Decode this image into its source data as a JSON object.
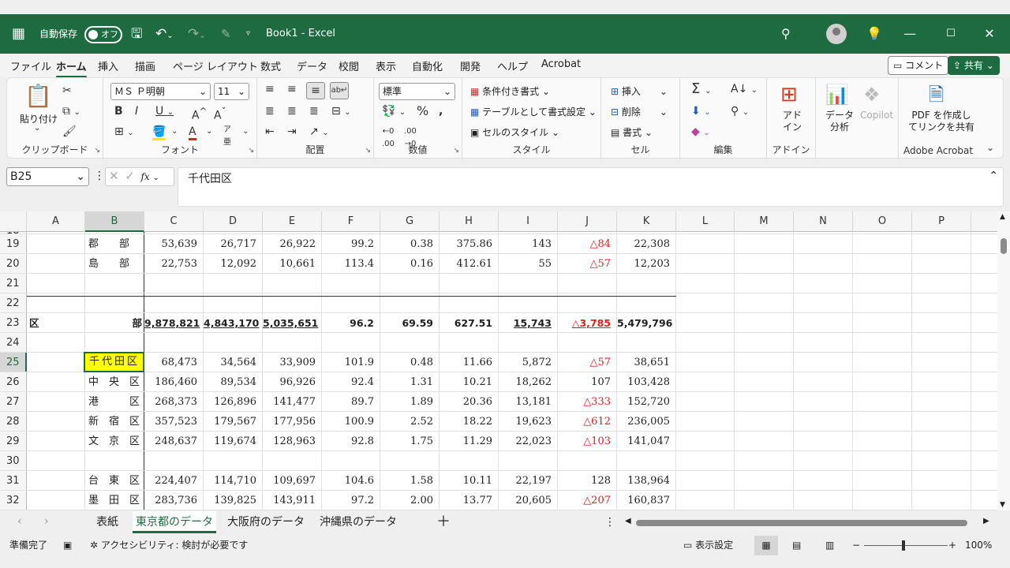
{
  "title": {
    "autosave_label": "自動保存",
    "autosave_state": "オフ",
    "filename": "Book1  -  Excel"
  },
  "menu": {
    "items": [
      "ファイル",
      "ホーム",
      "挿入",
      "描画",
      "ページ レイアウト",
      "数式",
      "データ",
      "校閲",
      "表示",
      "自動化",
      "開発",
      "ヘルプ",
      "Acrobat"
    ],
    "active": "ホーム",
    "comment_button": "コメント",
    "share_button": "共有"
  },
  "ribbon": {
    "clipboard": {
      "label": "クリップボード",
      "paste": "貼り付け"
    },
    "font": {
      "label": "フォント",
      "font_name": "ＭＳ Ｐ明朝",
      "font_size": "11"
    },
    "alignment": {
      "label": "配置"
    },
    "number": {
      "label": "数値",
      "format": "標準"
    },
    "styles": {
      "label": "スタイル",
      "conditional": "条件付き書式",
      "table": "テーブルとして書式設定",
      "cell_styles": "セルのスタイル"
    },
    "cells": {
      "label": "セル",
      "insert": "挿入",
      "delete": "削除",
      "format": "書式"
    },
    "editing": {
      "label": "編集"
    },
    "addins": {
      "label": "アドイン",
      "addin_button": "アド\nイン"
    },
    "analysis": {
      "data_analysis": "データ\n分析",
      "copilot": "Copilot"
    },
    "acrobat": {
      "label": "Adobe Acrobat",
      "pdf_button": "PDF を作成し\nてリンクを共有"
    }
  },
  "formula_bar": {
    "name_box": "B25",
    "fx": "fx",
    "value": "千代田区"
  },
  "grid": {
    "columns": [
      "A",
      "B",
      "C",
      "D",
      "E",
      "F",
      "G",
      "H",
      "I",
      "J",
      "K",
      "L",
      "M",
      "N",
      "O",
      "P"
    ],
    "selected_cell": "B25",
    "partial_top_row": "18",
    "rows": [
      {
        "num": "19",
        "b": "郡　　部",
        "c": "53,639",
        "d": "26,717",
        "e": "26,922",
        "f": "99.2",
        "g": "0.38",
        "h": "375.86",
        "i": "143",
        "j": "△84",
        "k": "22,308"
      },
      {
        "num": "20",
        "b": "島　　部",
        "c": "22,753",
        "d": "12,092",
        "e": "10,661",
        "f": "113.4",
        "g": "0.16",
        "h": "412.61",
        "i": "55",
        "j": "△57",
        "k": "12,203"
      },
      {
        "num": "21"
      },
      {
        "num": "22"
      },
      {
        "num": "23",
        "a": "区",
        "b": "部",
        "c": "9,878,821",
        "d": "4,843,170",
        "e": "5,035,651",
        "f": "96.2",
        "g": "69.59",
        "h": "627.51",
        "i": "15,743",
        "j": "△3,785",
        "k": "5,479,796"
      },
      {
        "num": "24"
      },
      {
        "num": "25",
        "b": "千代田区",
        "c": "68,473",
        "d": "34,564",
        "e": "33,909",
        "f": "101.9",
        "g": "0.48",
        "h": "11.66",
        "i": "5,872",
        "j": "△57",
        "k": "38,651"
      },
      {
        "num": "26",
        "b": "中　央　区",
        "c": "186,460",
        "d": "89,534",
        "e": "96,926",
        "f": "92.4",
        "g": "1.31",
        "h": "10.21",
        "i": "18,262",
        "j": "107",
        "k": "103,428"
      },
      {
        "num": "27",
        "b": "港　　　区",
        "c": "268,373",
        "d": "126,896",
        "e": "141,477",
        "f": "89.7",
        "g": "1.89",
        "h": "20.36",
        "i": "13,181",
        "j": "△333",
        "k": "152,720"
      },
      {
        "num": "28",
        "b": "新　宿　区",
        "c": "357,523",
        "d": "179,567",
        "e": "177,956",
        "f": "100.9",
        "g": "2.52",
        "h": "18.22",
        "i": "19,623",
        "j": "△612",
        "k": "236,005"
      },
      {
        "num": "29",
        "b": "文　京　区",
        "c": "248,637",
        "d": "119,674",
        "e": "128,963",
        "f": "92.8",
        "g": "1.75",
        "h": "11.29",
        "i": "22,023",
        "j": "△103",
        "k": "141,047"
      },
      {
        "num": "30"
      },
      {
        "num": "31",
        "b": "台　東　区",
        "c": "224,407",
        "d": "114,710",
        "e": "109,697",
        "f": "104.6",
        "g": "1.58",
        "h": "10.11",
        "i": "22,197",
        "j": "128",
        "k": "138,964"
      },
      {
        "num": "32",
        "b": "墨　田　区",
        "c": "283,736",
        "d": "139,825",
        "e": "143,911",
        "f": "97.2",
        "g": "2.00",
        "h": "13.77",
        "i": "20,605",
        "j": "△207",
        "k": "160,837"
      }
    ]
  },
  "sheets": {
    "tabs": [
      "表紙",
      "東京都のデータ",
      "大阪府のデータ",
      "沖縄県のデータ"
    ],
    "active": "東京都のデータ",
    "add": "＋"
  },
  "status": {
    "ready": "準備完了",
    "accessibility": "アクセシビリティ: 検討が必要です",
    "display_settings": "表示設定",
    "zoom": "100%"
  },
  "colors": {
    "excel_green": "#1e6b41",
    "negative": "#e02020",
    "selection_fill": "#ffff00"
  }
}
